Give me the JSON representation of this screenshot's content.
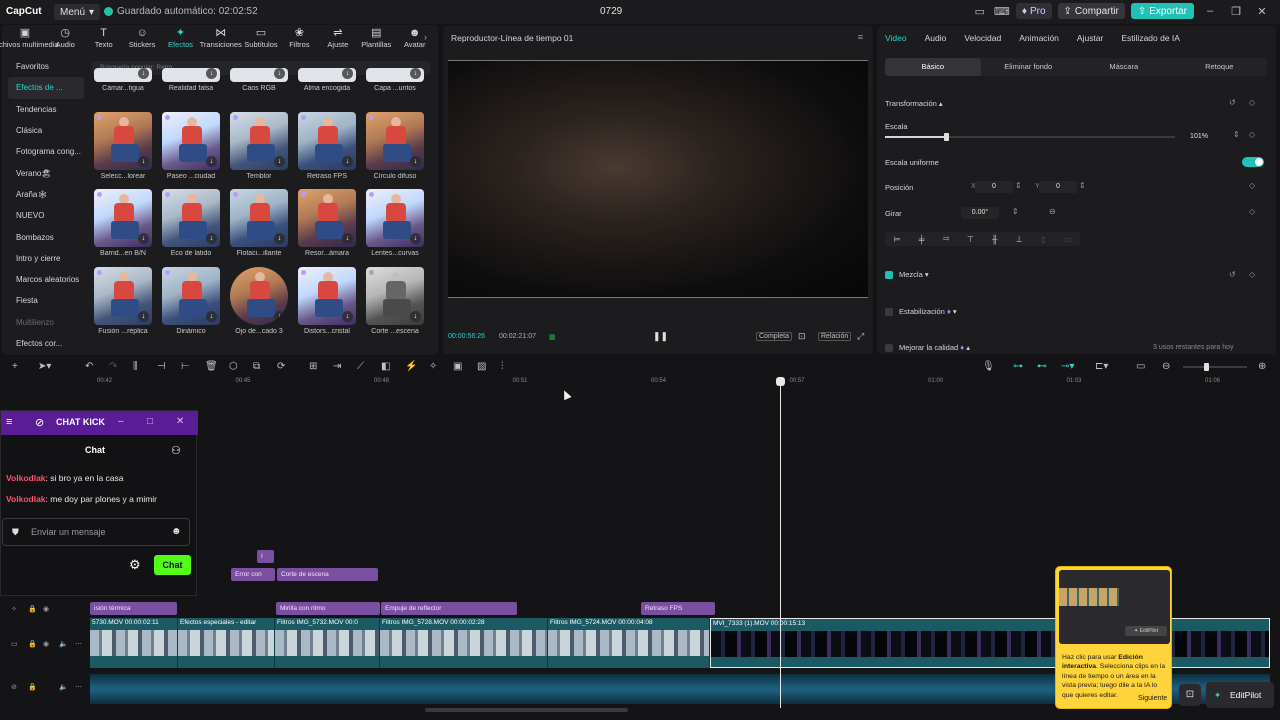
{
  "app": {
    "logo": "CapCut",
    "menu_label": "Menú",
    "autosave_text": "Guardado automático: 02:02:52",
    "project_title": "0729",
    "pro_label": "Pro",
    "share_label": "Compartir",
    "export_label": "Exportar"
  },
  "toolbar": {
    "tools": [
      {
        "label": "Archivos multimedia",
        "icon": "media-icon",
        "glyph": "▣"
      },
      {
        "label": "Audio",
        "icon": "audio-icon",
        "glyph": "◷"
      },
      {
        "label": "Texto",
        "icon": "text-icon",
        "glyph": "T"
      },
      {
        "label": "Stickers",
        "icon": "sticker-icon",
        "glyph": "☺"
      },
      {
        "label": "Efectos",
        "icon": "effects-icon",
        "glyph": "✦"
      },
      {
        "label": "Transiciones",
        "icon": "transitions-icon",
        "glyph": "⋈"
      },
      {
        "label": "Subtítulos",
        "icon": "subtitles-icon",
        "glyph": "▭"
      },
      {
        "label": "Filtros",
        "icon": "filters-icon",
        "glyph": "❀"
      },
      {
        "label": "Ajuste",
        "icon": "adjust-icon",
        "glyph": "⇌"
      },
      {
        "label": "Plantillas",
        "icon": "templates-icon",
        "glyph": "▤"
      },
      {
        "label": "Avatar",
        "icon": "avatar-icon",
        "glyph": "☻"
      }
    ],
    "active_tool": "Efectos"
  },
  "library": {
    "sidebar": [
      "Favoritos",
      "Efectos de ...",
      "Tendencias",
      "Clásica",
      "Fotograma cong...",
      "Verano🏖",
      "Araña🕸",
      "NUEVO",
      "Bombazos",
      "Intro y cierre",
      "Marcos aleatorios",
      "Fiesta",
      "Multilienzo",
      "Efectos cor..."
    ],
    "search_placeholder": "Búsqueda popular: Retro",
    "rows": [
      [
        "Cámar...tigua",
        "Realidad falsa",
        "Caos RGB",
        "Alma encogida",
        "Capa ...untos"
      ],
      [
        "Selecc...lorear",
        "Paseo ...ciudad",
        "Temblor",
        "Retraso FPS",
        "Círculo difuso"
      ],
      [
        "Barrid...en B/N",
        "Eco de latido",
        "Flotaci...illante",
        "Resor...ámara",
        "Lentes...curvas"
      ],
      [
        "Fusión ...réplica",
        "Dinámico",
        "Ojo de...cado 3",
        "Distors...cristal",
        "Corte ...escena"
      ]
    ]
  },
  "player": {
    "title": "Reproductor-Línea de tiempo 01",
    "current_time": "00:00:56:26",
    "total_time": "00:02:21:07",
    "full_label": "Completa",
    "ratio_label": "Relación"
  },
  "inspector": {
    "tabs": [
      "Video",
      "Audio",
      "Velocidad",
      "Animación",
      "Ajustar",
      "Estilizado de IA"
    ],
    "subtabs": [
      "Básico",
      "Eliminar fondo",
      "Máscara",
      "Retoque"
    ],
    "transform_label": "Transformación",
    "scale_label": "Escala",
    "scale_value": "101%",
    "scale_fraction": 0.21,
    "uniform_scale_label": "Escala uniforme",
    "uniform_scale_on": true,
    "position_label": "Posición",
    "pos_x_label": "X",
    "pos_x": "0",
    "pos_y_label": "Y",
    "pos_y": "0",
    "rotate_label": "Girar",
    "rotate_value": "0.00°",
    "blend_label": "Mezcla",
    "stabilize_label": "Estabilización",
    "quality_label": "Mejorar la calidad",
    "quality_note": "3 usos restantes para hoy"
  },
  "timeline": {
    "ticks": [
      "00:42",
      "00:45",
      "00:48",
      "00:51",
      "00:54",
      "00:57",
      "01:00",
      "01:03",
      "01:06"
    ],
    "fx_clips_upper": [
      {
        "label": "I"
      },
      {
        "label": "Error con"
      },
      {
        "label": "Corte de escena"
      }
    ],
    "fx_clips_lower": [
      {
        "label": "isión térmica"
      },
      {
        "label": "Mirilla con ritmo"
      },
      {
        "label": "Empuje de reflector"
      },
      {
        "label": "Retraso FPS"
      }
    ],
    "video_clips": [
      {
        "label": "5730.MOV  00:00:02:11"
      },
      {
        "label": "Efectos especiales - editar"
      },
      {
        "label": "Filtros  IMG_5732.MOV  00:0"
      },
      {
        "label": "Filtros  IMG_5728.MOV  00:00:02:28"
      },
      {
        "label": "Filtros  IMG_5724.MOV  00:00:04:08"
      },
      {
        "label": "MVI_7333 (1).MOV  00:00:15:13"
      }
    ]
  },
  "chat": {
    "window_title": "CHAT KICK",
    "header": "Chat",
    "messages": [
      {
        "user": "Volkodlak",
        "text": ": si bro ya en la casa"
      },
      {
        "user": "Volkodlak",
        "text": ": me doy par plones y a mimir"
      }
    ],
    "input_placeholder": "Enviar un mensaje",
    "send_label": "Chat"
  },
  "tooltip": {
    "text_pre": "Haz clic para usar ",
    "text_bold": "Edición interactiva",
    "text_post": ". Selecciona clips en la línea de tiempo o un área en la vista previa; luego dile a la IA lo que quieres editar.",
    "next_label": "Siguiente"
  },
  "editpilot_label": "EditPilot",
  "colors": {
    "accent": "#2ed2c8",
    "export": "#22c1b8",
    "fx_clip": "#7a4fa0",
    "kick_header": "#5b1d96",
    "kick_green": "#53fc18",
    "tooltip": "#ffd33a"
  }
}
